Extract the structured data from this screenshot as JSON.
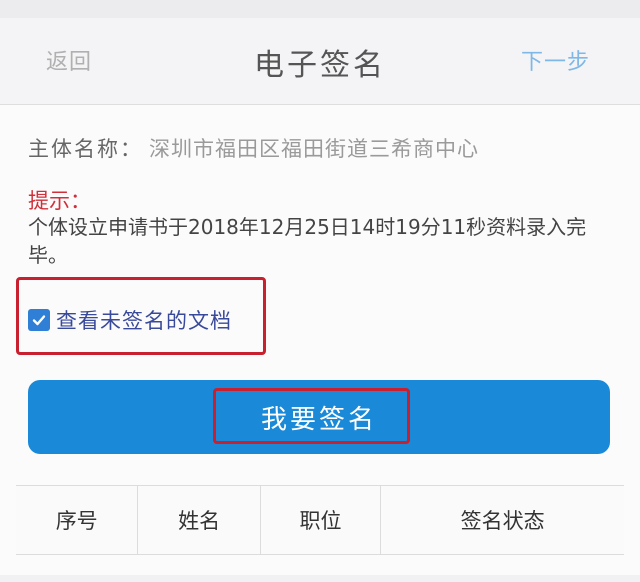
{
  "header": {
    "back_label": "返回",
    "title": "电子签名",
    "next_label": "下一步"
  },
  "entity": {
    "label": "主体名称：",
    "value": "深圳市福田区福田街道三希商中心"
  },
  "hint": {
    "title": "提示：",
    "text": "个体设立申请书于2018年12月25日14时19分11秒资料录入完毕。"
  },
  "checkbox": {
    "label": "查看未签名的文档",
    "checked": true
  },
  "sign_button": {
    "label": "我要签名"
  },
  "table": {
    "headers": [
      "序号",
      "姓名",
      "职位",
      "签名状态"
    ]
  },
  "colors": {
    "accent": "#1a8ad8",
    "highlight": "#c8202e",
    "hint": "#d0303a"
  }
}
